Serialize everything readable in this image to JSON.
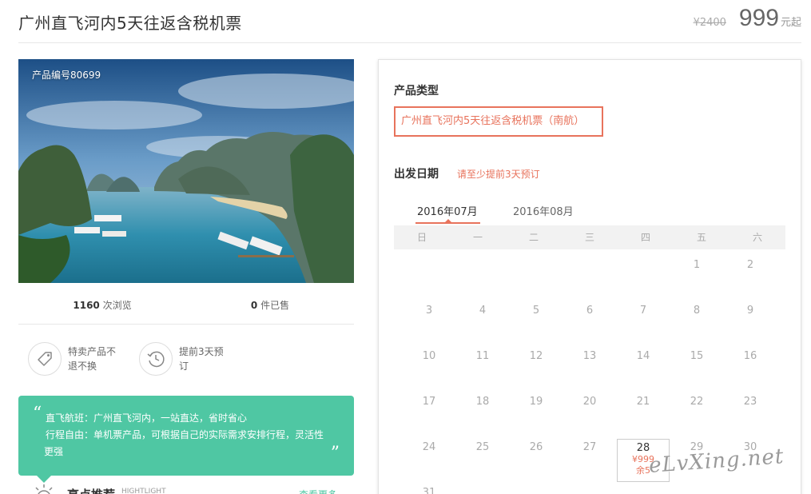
{
  "header": {
    "title": "广州直飞河内5天往返含税机票",
    "original_price": "¥2400",
    "price": "999",
    "price_suffix": "元起"
  },
  "product": {
    "code_label": "产品编号80699",
    "views_count": "1160",
    "views_label": "次浏览",
    "sold_count": "0",
    "sold_label": "件已售"
  },
  "features": [
    {
      "icon": "tag-icon",
      "line1": "特卖产品不",
      "line2": "退不换"
    },
    {
      "icon": "clock-icon",
      "line1": "提前3天预",
      "line2": "订"
    }
  ],
  "highlights": {
    "line1": "直飞航班：广州直飞河内，一站直达，省时省心",
    "line2": "行程自由：单机票产品，可根据自己的实际需求安排行程，灵活性",
    "line3": "更强"
  },
  "recommend": {
    "title": "亮点推荐",
    "subtitle": "HIGHTLIGHT",
    "more": "查看更多"
  },
  "booking": {
    "product_type_label": "产品类型",
    "product_type_option": "广州直飞河内5天往返含税机票（南航）",
    "date_label": "出发日期",
    "date_hint": "请至少提前3天预订",
    "months": [
      "2016年07月",
      "2016年08月"
    ],
    "weekdays": [
      "日",
      "一",
      "二",
      "三",
      "四",
      "五",
      "六"
    ],
    "days": [
      "1",
      "2",
      "3",
      "4",
      "5",
      "6",
      "7",
      "8",
      "9",
      "10",
      "11",
      "12",
      "13",
      "14",
      "15",
      "16",
      "17",
      "18",
      "19",
      "20",
      "21",
      "22",
      "23",
      "24",
      "25",
      "26",
      "27",
      "28",
      "29",
      "30",
      "31"
    ],
    "available_day": {
      "day": "28",
      "price": "¥999",
      "stock": "余5"
    }
  },
  "watermark": "eLvXing.net",
  "colors": {
    "accent": "#e8735c",
    "highlight_green": "#4fc7a3"
  }
}
